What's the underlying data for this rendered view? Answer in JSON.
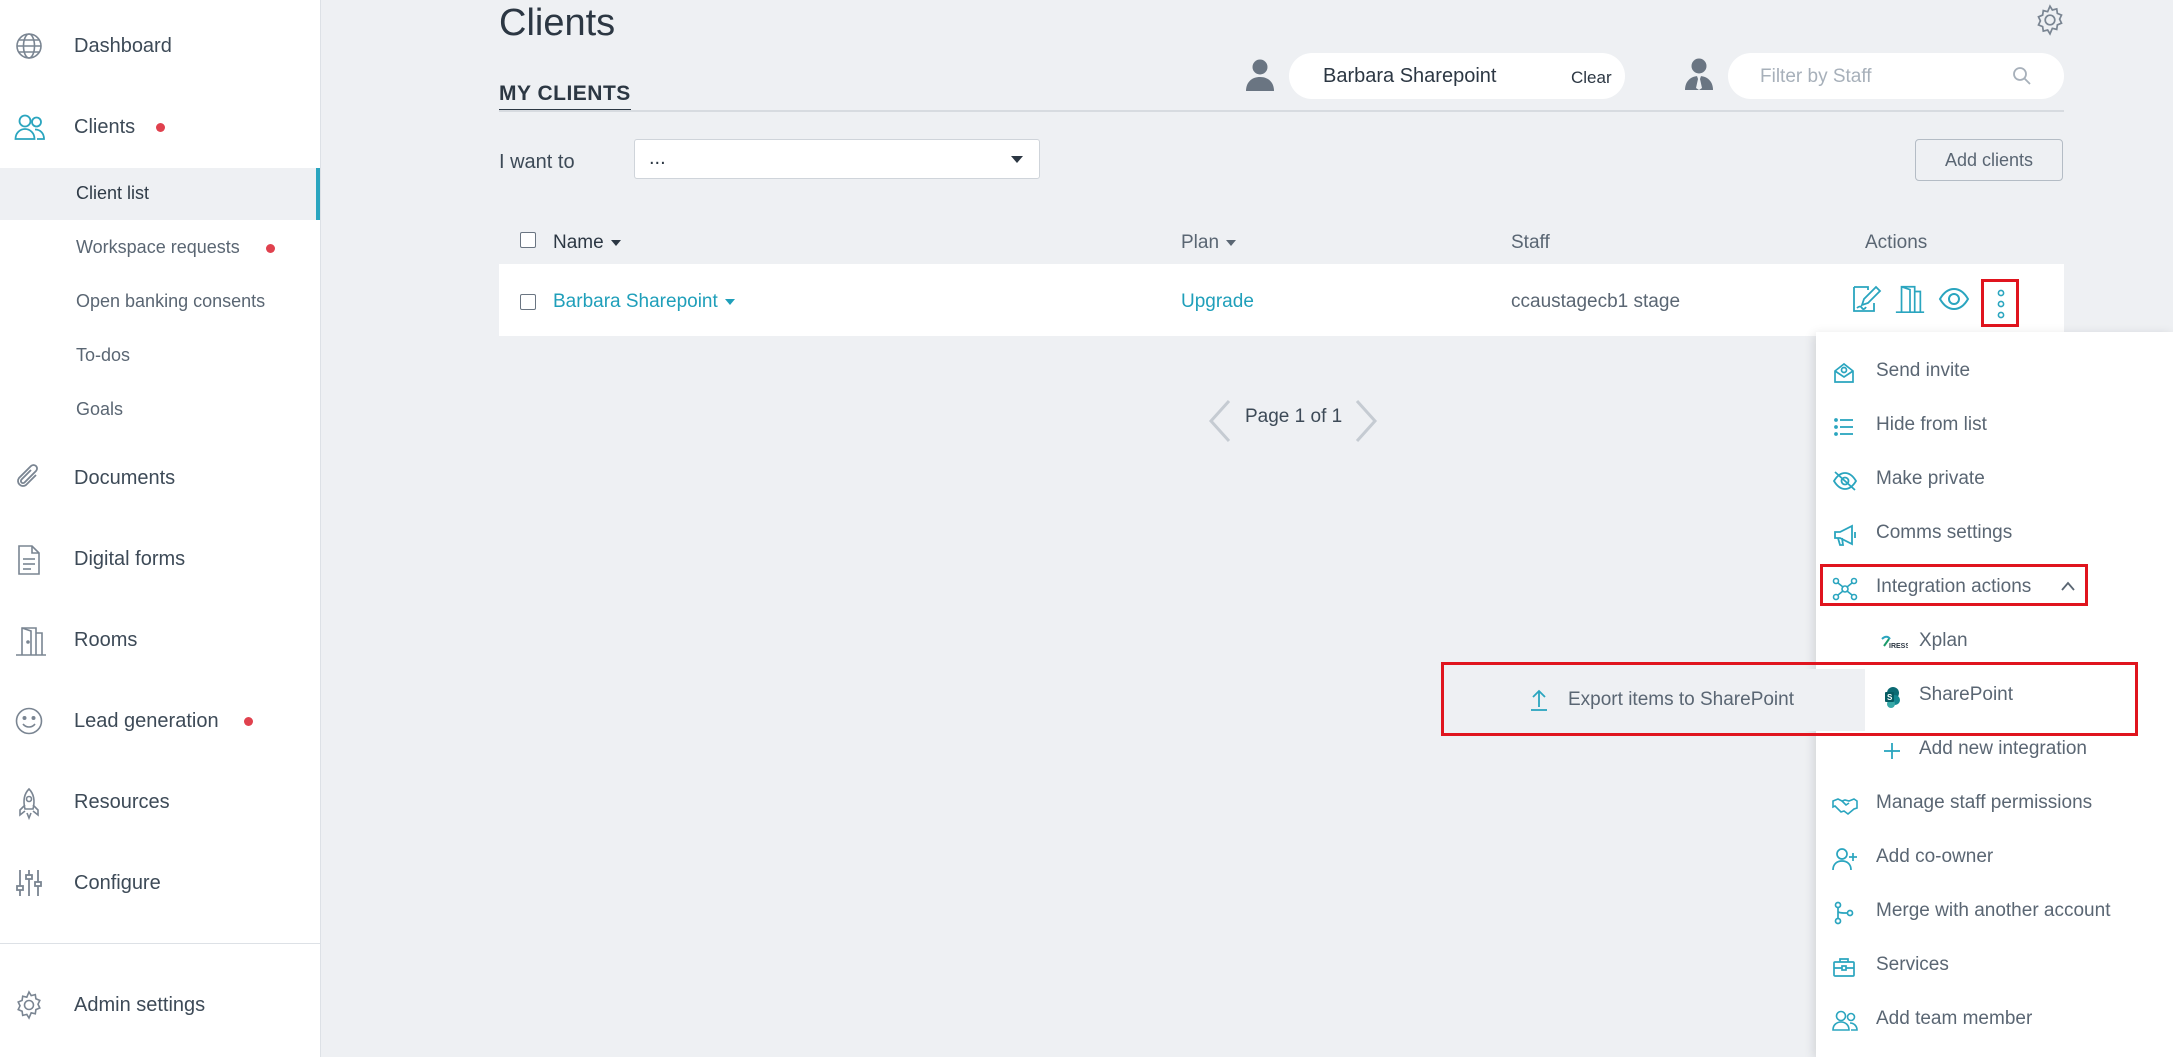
{
  "sidebar": {
    "items": [
      {
        "label": "Dashboard",
        "icon": "globe-icon"
      },
      {
        "label": "Clients",
        "icon": "users-icon",
        "badge": true
      },
      {
        "label": "Documents",
        "icon": "paperclip-icon"
      },
      {
        "label": "Digital forms",
        "icon": "document-icon"
      },
      {
        "label": "Rooms",
        "icon": "door-icon"
      },
      {
        "label": "Lead generation",
        "icon": "smiley-icon",
        "badge": true
      },
      {
        "label": "Resources",
        "icon": "rocket-icon"
      },
      {
        "label": "Configure",
        "icon": "sliders-icon"
      }
    ],
    "subitems": [
      {
        "label": "Client list"
      },
      {
        "label": "Workspace requests",
        "badge": true
      },
      {
        "label": "Open banking consents"
      },
      {
        "label": "To-dos"
      },
      {
        "label": "Goals"
      }
    ],
    "admin": {
      "label": "Admin settings",
      "icon": "gear-icon"
    }
  },
  "page": {
    "title": "Clients",
    "tab": "MY CLIENTS"
  },
  "filters": {
    "client_name": "Barbara Sharepoint",
    "clear_label": "Clear",
    "staff_placeholder": "Filter by Staff"
  },
  "toolbar": {
    "i_want_label": "I want to",
    "i_want_value": "...",
    "add_clients_label": "Add clients"
  },
  "table": {
    "headers": {
      "name": "Name",
      "plan": "Plan",
      "staff": "Staff",
      "actions": "Actions"
    },
    "rows": [
      {
        "name": "Barbara Sharepoint",
        "plan": "Upgrade",
        "staff": "ccaustagecb1 stage"
      }
    ]
  },
  "pagination": {
    "text": "Page 1 of 1"
  },
  "menu": {
    "items": [
      {
        "label": "Send invite",
        "icon": "envelope-icon"
      },
      {
        "label": "Hide from list",
        "icon": "list-icon"
      },
      {
        "label": "Make private",
        "icon": "eye-slash-icon"
      },
      {
        "label": "Comms settings",
        "icon": "megaphone-icon"
      },
      {
        "label": "Integration actions",
        "icon": "network-icon"
      },
      {
        "label": "Xplan",
        "icon": "xplan-logo-icon"
      },
      {
        "label": "SharePoint",
        "icon": "sharepoint-icon"
      },
      {
        "label": "Add new integration",
        "icon": "plus-icon"
      },
      {
        "label": "Manage staff permissions",
        "icon": "handshake-icon"
      },
      {
        "label": "Add co-owner",
        "icon": "user-plus-icon"
      },
      {
        "label": "Merge with another account",
        "icon": "merge-icon"
      },
      {
        "label": "Services",
        "icon": "briefcase-icon"
      },
      {
        "label": "Add team member",
        "icon": "team-icon"
      }
    ],
    "flyout": {
      "label": "Export items to SharePoint",
      "icon": "upload-icon"
    }
  },
  "colors": {
    "accent": "#2aa5bf",
    "badge": "#e0414e",
    "highlight": "#e0141e"
  }
}
